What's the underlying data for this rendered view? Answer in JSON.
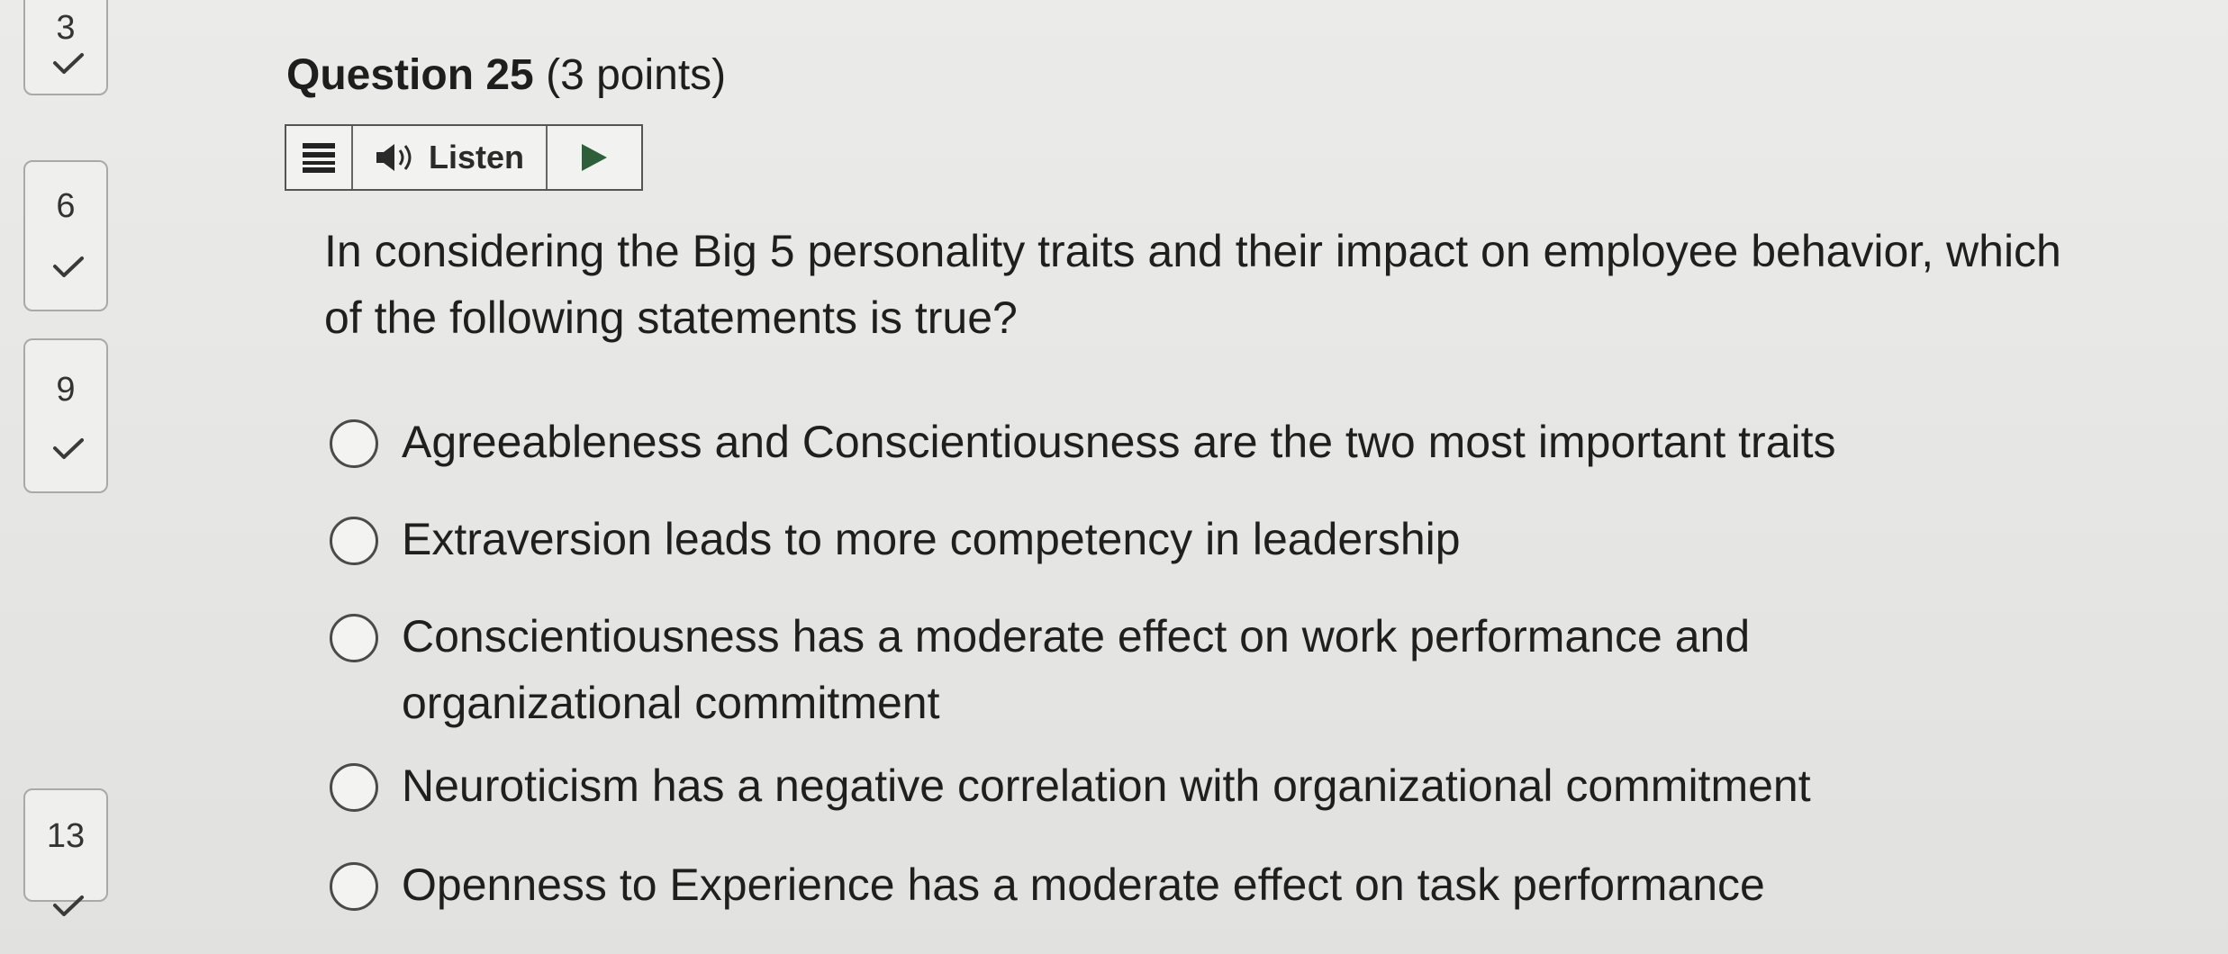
{
  "nav": {
    "items": [
      {
        "number": "3",
        "status": "answered"
      },
      {
        "number": "6",
        "status": "answered"
      },
      {
        "number": "9",
        "status": "answered"
      },
      {
        "number": "13",
        "status": "answered"
      }
    ]
  },
  "question": {
    "title": "Question 25",
    "points": "(3 points)",
    "text": "In considering the Big 5 personality traits and their impact on employee behavior, which of the following statements is true?"
  },
  "toolbar": {
    "listen_label": "Listen",
    "icons": [
      "menu-icon",
      "speaker-icon",
      "play-icon"
    ]
  },
  "options": [
    {
      "label": "Agreeableness and Conscientiousness are the two most important traits"
    },
    {
      "label": "Extraversion leads to more competency in leadership"
    },
    {
      "label": "Conscientiousness has a moderate effect on work performance and organizational commitment"
    },
    {
      "label": "Neuroticism has a negative correlation with organizational commitment"
    },
    {
      "label": "Openness to Experience has a moderate effect on task performance"
    }
  ],
  "colors": {
    "background": "#e6e6e4",
    "text": "#1f1f1f",
    "border": "#555555"
  }
}
